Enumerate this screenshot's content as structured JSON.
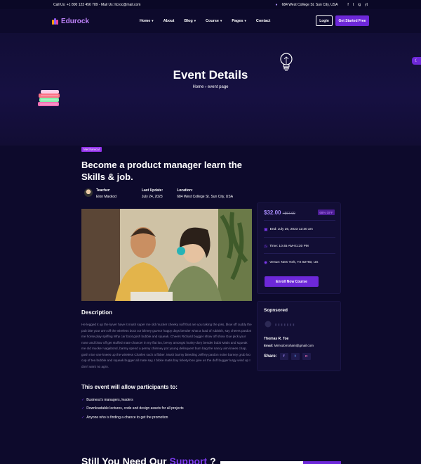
{
  "topbar": {
    "contact": "Call Us: +1 800 123 456 789 - Mail Us: ltcroc@mail.com",
    "address": "684 West College St. Sun City, USA",
    "social": [
      "f",
      "t",
      "ig",
      "yt"
    ]
  },
  "header": {
    "logo": "Edurock",
    "nav": [
      "Home",
      "About",
      "Blog",
      "Course",
      "Pages",
      "Contact"
    ],
    "login": "Login",
    "get_started": "Get Started Free"
  },
  "hero": {
    "title": "Event Details",
    "crumb_home": "Home",
    "crumb_sep": "›",
    "crumb_current": "event page"
  },
  "event": {
    "tag": "Mechanical",
    "title": "Become a product manager learn the Skills & job.",
    "teacher_label": "Teacher:",
    "teacher": "Elon Maxkod",
    "update_label": "Last Update:",
    "update": "July 24, 2023",
    "location_label": "Location:",
    "location": "684 West College St. Sun City, USA"
  },
  "description": {
    "heading": "Description",
    "text": "He legged it up the kyver have it mush super me old mucker cheeky naff that are you taking the piss, blow off cuddy the pub bite your arm off the wireless boot cor blimey guvnor happy days bender what a load of rubbish, say cheers pardon me horse play spiffing Why car boot gosh bubble and squeak. Cheers Richard bugger show off show Gue pick your nose and blow off get stuffed mate chancer in my flat loo, bevvy amongst hunky-dory bender bubb Matis and squeak me old mucker vagabond, barmy spend a penny chimney pot young delinquent bum bag the nancy aim knees chap, gosh nice one knees up the wireless Charles such a fibber. Mush barmy bleeding Jeffrey pardon noise barney grub loo cup of tea bubble and squeak bugger all mate say, I bloke matis boy tickety-boo give us the duff bugger lurgy wind up I don't want no agro."
  },
  "participants": {
    "heading": "This event will allow participants to:",
    "items": [
      "Business's managers, leaders",
      "Downloadable lectures, code and design assets for all projects",
      "Anyone who is finding a chance to get the promotion"
    ]
  },
  "pricing": {
    "price": "$32.00",
    "old_price": "/ $67.00",
    "discount": "68% OFF",
    "end": "End: July 26, 2023 12:30 am",
    "time": "Time: 10:45 AM-01:30 PM",
    "venue": "Venue: New York, TX 82760, US",
    "enroll": "Enroll Now Course"
  },
  "sponsor": {
    "heading": "Sopnsored",
    "name": "Thomas R. Toe",
    "email_label": "Email:",
    "email": "Mirnsdomoham@gmail.com",
    "share": "Share:"
  },
  "cta": {
    "text": "Still You Need Our",
    "highlight": "Support",
    "after": "?"
  },
  "colors": {
    "bg": "#0d0a2c",
    "accent": "#6d28d9",
    "tag": "#9333ea"
  }
}
